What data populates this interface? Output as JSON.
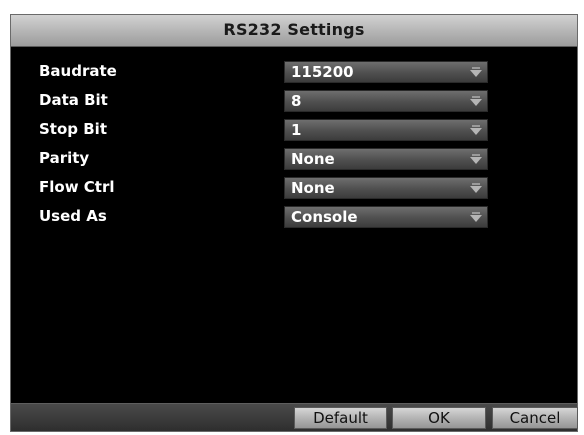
{
  "dialog": {
    "title": "RS232 Settings"
  },
  "fields": [
    {
      "label": "Baudrate",
      "value": "115200"
    },
    {
      "label": "Data Bit",
      "value": "8"
    },
    {
      "label": "Stop Bit",
      "value": "1"
    },
    {
      "label": "Parity",
      "value": "None"
    },
    {
      "label": "Flow Ctrl",
      "value": "None"
    },
    {
      "label": "Used As",
      "value": "Console"
    }
  ],
  "buttons": {
    "default_label": "Default",
    "ok_label": "OK",
    "cancel_label": "Cancel"
  },
  "icons": {
    "dropdown": "chevron-down-icon"
  },
  "colors": {
    "background": "#000000",
    "titlebar": "#bcbcbc",
    "field": "#555555",
    "text": "#ffffff"
  }
}
